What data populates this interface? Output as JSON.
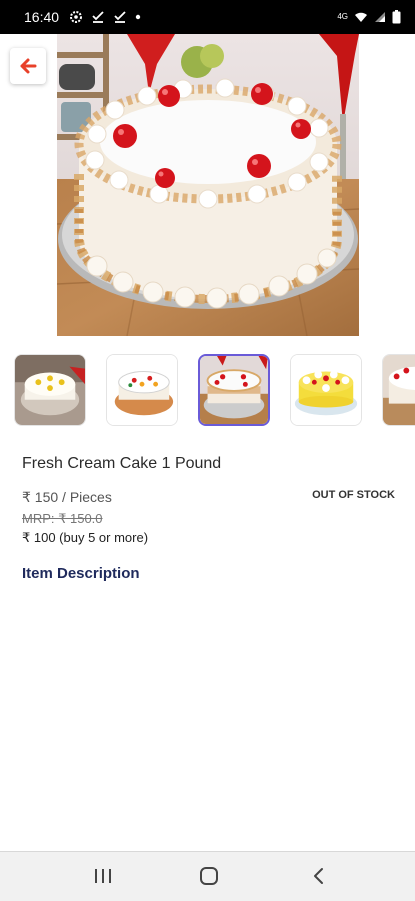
{
  "status_bar": {
    "time": "16:40",
    "network": "4G",
    "icons": [
      "settings-icon",
      "check-icon",
      "check-icon",
      "dot-icon",
      "wifi-icon",
      "signal-icon",
      "battery-icon"
    ]
  },
  "product": {
    "title": "Fresh Cream Cake 1 Pound",
    "price": "₹ 150 / Pieces",
    "stock_status": "OUT OF STOCK",
    "mrp": "MRP: ₹ 150.0",
    "bulk_price": "₹ 100 (buy 5 or more)",
    "description_heading": "Item Description",
    "thumbnail_count": 5,
    "selected_thumbnail": 3
  },
  "colors": {
    "accent": "#e8412a",
    "selected_border": "#6a5bd8",
    "heading": "#1f2a5c"
  },
  "nav_bar": {
    "buttons": [
      "recent-apps-icon",
      "home-icon",
      "back-icon"
    ]
  }
}
